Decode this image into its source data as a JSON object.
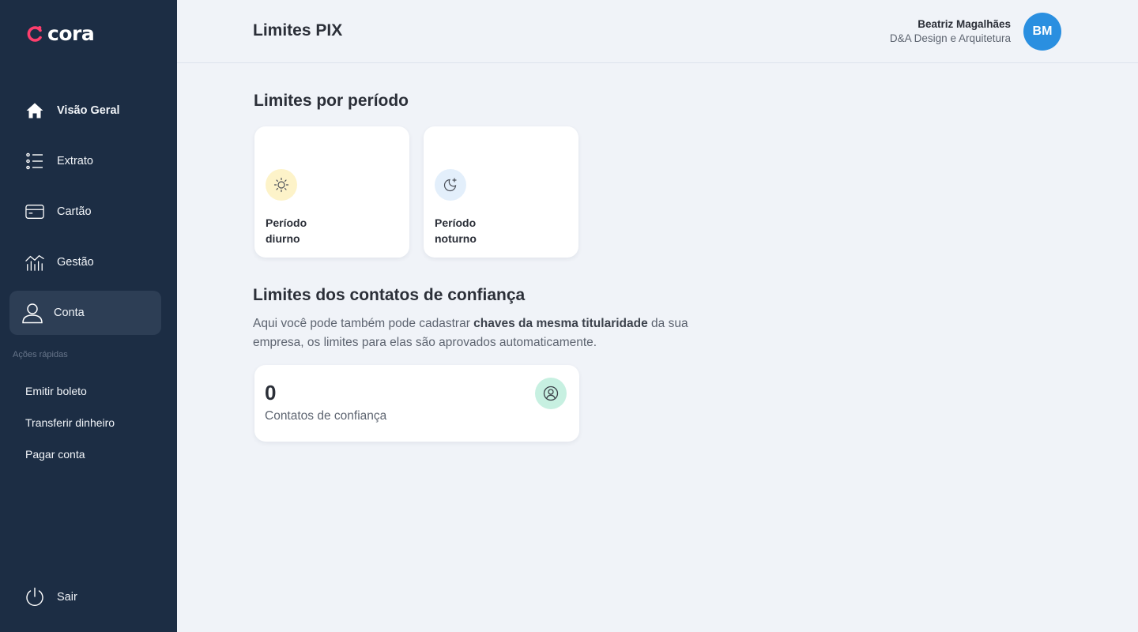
{
  "brand": {
    "name": "cora",
    "accent": "#fe3e6d"
  },
  "sidebar": {
    "nav": [
      {
        "label": "Visão Geral",
        "icon": "home-icon"
      },
      {
        "label": "Extrato",
        "icon": "list-icon"
      },
      {
        "label": "Cartão",
        "icon": "card-icon"
      },
      {
        "label": "Gestão",
        "icon": "chart-icon"
      },
      {
        "label": "Conta",
        "icon": "user-icon",
        "active": true
      }
    ],
    "quick_actions_label": "Ações rápidas",
    "quick_actions": [
      "Emitir boleto",
      "Transferir dinheiro",
      "Pagar conta"
    ],
    "logout": {
      "label": "Sair",
      "icon": "power-icon"
    }
  },
  "header": {
    "title": "Limites PIX",
    "user": {
      "name": "Beatriz Magalhães",
      "company": "D&A Design e Arquitetura",
      "initials": "BM",
      "avatar_color": "#2a8fe0"
    }
  },
  "periods": {
    "title": "Limites por período",
    "cards": [
      {
        "line1": "Período",
        "line2": "diurno",
        "icon": "sun-icon",
        "bubble_color": "#fdf3c9"
      },
      {
        "line1": "Período",
        "line2": "noturno",
        "icon": "moon-icon",
        "bubble_color": "#e3effb"
      }
    ]
  },
  "trusted": {
    "title": "Limites dos contatos de confiança",
    "desc_before": "Aqui você pode também pode cadastrar ",
    "desc_bold": "chaves da mesma titularidade",
    "desc_after": " da sua empresa, os limites para elas são aprovados automaticamente.",
    "count": "0",
    "count_label": "Contatos de confiança",
    "icon": "user-circle-icon"
  }
}
